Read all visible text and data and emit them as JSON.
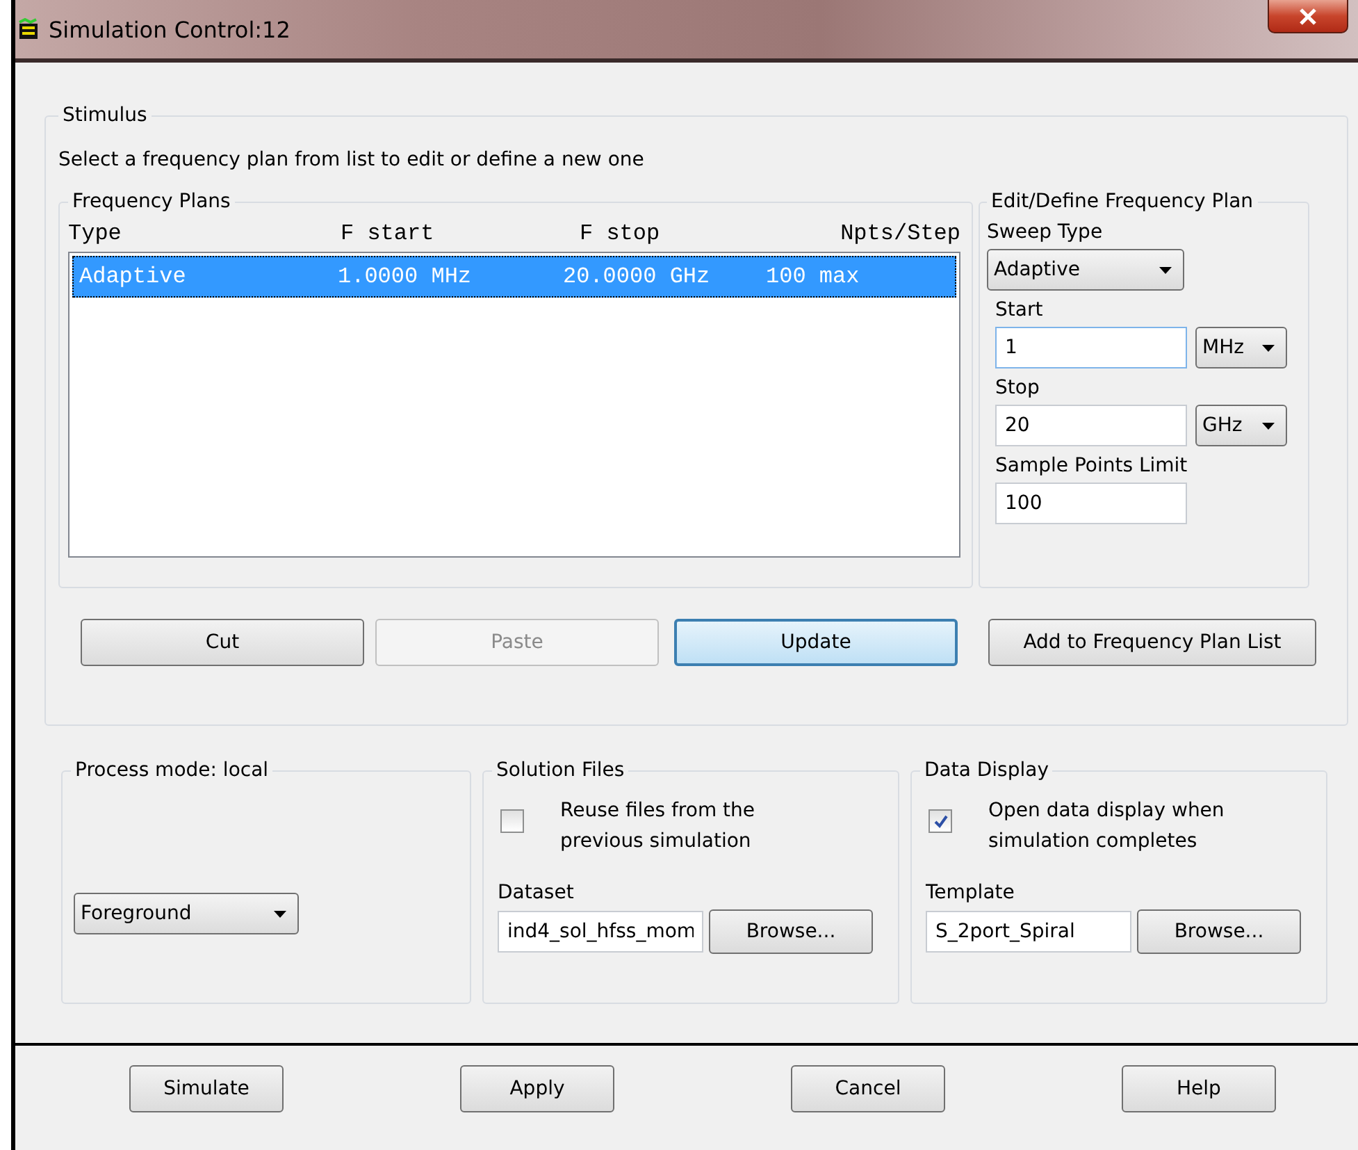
{
  "window": {
    "title": "Simulation Control:12"
  },
  "stimulus": {
    "title": "Stimulus",
    "instruction": "Select a frequency plan from list to edit or define a new one",
    "frequency_plans": {
      "title": "Frequency Plans",
      "columns": [
        "Type",
        "F start",
        "F stop",
        "Npts/Step"
      ],
      "rows": [
        {
          "cells": [
            "Adaptive",
            "1.0000 MHz",
            "20.0000 GHz",
            "100 max"
          ],
          "selected": true
        }
      ]
    },
    "edit_plan": {
      "title": "Edit/Define Frequency Plan",
      "sweep_type": {
        "label": "Sweep Type",
        "value": "Adaptive"
      },
      "start": {
        "label": "Start",
        "value": "1",
        "unit": "MHz"
      },
      "stop": {
        "label": "Stop",
        "value": "20",
        "unit": "GHz"
      },
      "sample_points_limit": {
        "label": "Sample Points Limit",
        "value": "100"
      }
    },
    "buttons": [
      {
        "label": "Cut",
        "disabled": false,
        "focused": false
      },
      {
        "label": "Paste",
        "disabled": true,
        "focused": false
      },
      {
        "label": "Update",
        "disabled": false,
        "focused": true
      },
      {
        "label": "Add to Frequency Plan List",
        "disabled": false,
        "focused": false
      }
    ]
  },
  "process_mode": {
    "title": "Process mode: local",
    "mode": "Foreground"
  },
  "solution_files": {
    "title": "Solution Files",
    "reuse": {
      "label": "Reuse files from the previous simulation",
      "checked": false
    },
    "dataset": {
      "label": "Dataset",
      "value": "ind4_sol_hfss_mom",
      "button": "Browse..."
    }
  },
  "data_display": {
    "title": "Data Display",
    "open_display": {
      "label": "Open data display when simulation completes",
      "checked": true
    },
    "template": {
      "label": "Template",
      "value": "S_2port_Spiral",
      "button": "Browse..."
    }
  },
  "footer_buttons": [
    "Simulate",
    "Apply",
    "Cancel",
    "Help"
  ]
}
